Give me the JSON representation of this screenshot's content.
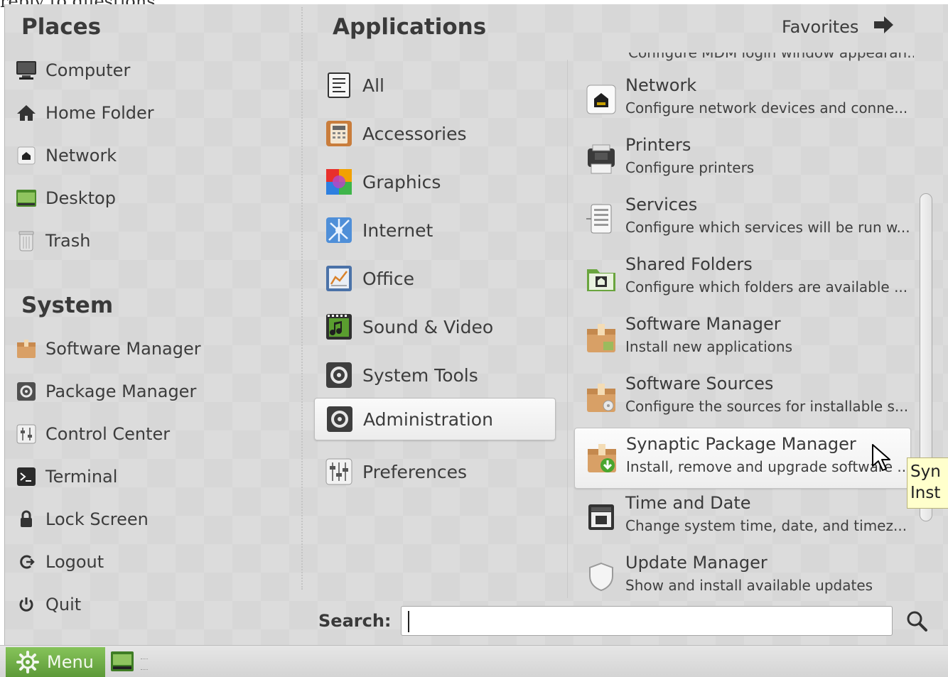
{
  "top_fragment": "reply to questions",
  "places": {
    "heading": "Places",
    "items": [
      {
        "label": "Computer",
        "icon": "computer-icon"
      },
      {
        "label": "Home Folder",
        "icon": "home-icon"
      },
      {
        "label": "Network",
        "icon": "network-icon"
      },
      {
        "label": "Desktop",
        "icon": "desktop-icon"
      },
      {
        "label": "Trash",
        "icon": "trash-icon"
      }
    ]
  },
  "system": {
    "heading": "System",
    "items": [
      {
        "label": "Software Manager",
        "icon": "software-manager-icon"
      },
      {
        "label": "Package Manager",
        "icon": "package-manager-icon"
      },
      {
        "label": "Control Center",
        "icon": "control-center-icon"
      },
      {
        "label": "Terminal",
        "icon": "terminal-icon"
      },
      {
        "label": "Lock Screen",
        "icon": "lock-icon"
      },
      {
        "label": "Logout",
        "icon": "logout-icon"
      },
      {
        "label": "Quit",
        "icon": "power-icon"
      }
    ]
  },
  "applications": {
    "heading": "Applications",
    "favorites_label": "Favorites",
    "categories": [
      {
        "label": "All",
        "icon": "all-icon"
      },
      {
        "label": "Accessories",
        "icon": "accessories-icon"
      },
      {
        "label": "Graphics",
        "icon": "graphics-icon"
      },
      {
        "label": "Internet",
        "icon": "internet-icon"
      },
      {
        "label": "Office",
        "icon": "office-icon"
      },
      {
        "label": "Sound & Video",
        "icon": "sound-video-icon"
      },
      {
        "label": "System Tools",
        "icon": "system-tools-icon"
      },
      {
        "label": "Administration",
        "icon": "administration-icon",
        "selected": true
      },
      {
        "label": "Preferences",
        "icon": "preferences-icon"
      }
    ],
    "apps": [
      {
        "name": "Network",
        "desc": "Configure network devices and conne...",
        "icon": "network-app-icon"
      },
      {
        "name": "Printers",
        "desc": "Configure printers",
        "icon": "printer-icon"
      },
      {
        "name": "Services",
        "desc": "Configure which services will be run w...",
        "icon": "services-icon"
      },
      {
        "name": "Shared Folders",
        "desc": "Configure which folders are available ...",
        "icon": "shared-folders-icon"
      },
      {
        "name": "Software Manager",
        "desc": "Install new applications",
        "icon": "software-manager-app-icon"
      },
      {
        "name": "Software Sources",
        "desc": "Configure the sources for installable s...",
        "icon": "software-sources-icon"
      },
      {
        "name": "Synaptic Package Manager",
        "desc": "Install, remove and upgrade software ...",
        "icon": "synaptic-icon",
        "hover": true
      },
      {
        "name": "Time and Date",
        "desc": "Change system time, date, and timez...",
        "icon": "calendar-icon"
      },
      {
        "name": "Update Manager",
        "desc": "Show and install available updates",
        "icon": "shield-icon"
      }
    ],
    "partial_top_desc": "Configure MDM login window appearan..."
  },
  "search": {
    "label": "Search:",
    "value": ""
  },
  "tooltip": {
    "line1": "Syn",
    "line2": "Inst"
  },
  "taskbar": {
    "menu_label": "Menu"
  },
  "colors": {
    "menu_green": "#6fae45",
    "panel_bg": "#dcdcdc",
    "tooltip_bg": "#ffffcc"
  }
}
